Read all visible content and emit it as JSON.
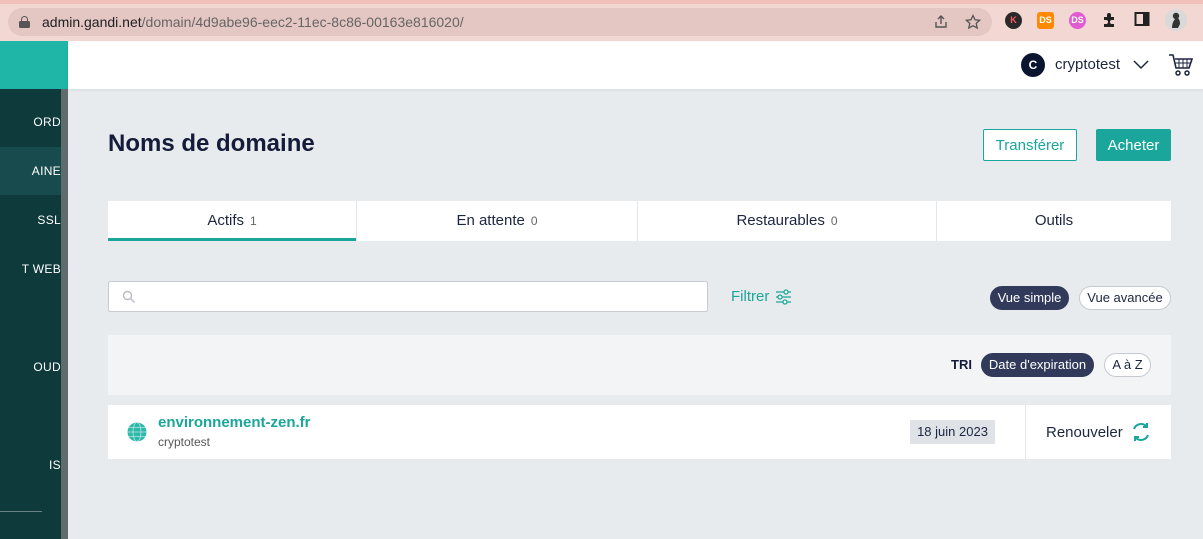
{
  "browser": {
    "url_host": "admin.gandi.net",
    "url_path": "/domain/4d9abe96-eec2-11ec-8c86-00163e816020/",
    "extensions": [
      {
        "name": "k-extension-icon",
        "label": "K"
      },
      {
        "name": "ds-extension-icon",
        "label": "DS"
      },
      {
        "name": "ds-pink-extension-icon",
        "label": "DS"
      }
    ]
  },
  "sidebar": {
    "items": [
      {
        "label": "ORD"
      },
      {
        "label": "AINE"
      },
      {
        "label": "SSL"
      },
      {
        "label": "T WEB"
      },
      {
        "label": "OUD"
      },
      {
        "label": "IS"
      }
    ],
    "active_index": 1
  },
  "header": {
    "avatar_letter": "C",
    "username": "cryptotest"
  },
  "page": {
    "title": "Noms de domaine",
    "transfer_label": "Transférer",
    "buy_label": "Acheter"
  },
  "tabs": [
    {
      "label": "Actifs",
      "count": "1",
      "active": true
    },
    {
      "label": "En attente",
      "count": "0",
      "active": false
    },
    {
      "label": "Restaurables",
      "count": "0",
      "active": false
    },
    {
      "label": "Outils",
      "count": "",
      "active": false
    }
  ],
  "search": {
    "value": "",
    "filter_label": "Filtrer"
  },
  "view": {
    "simple_label": "Vue simple",
    "advanced_label": "Vue avancée",
    "selected": "simple"
  },
  "sort": {
    "label": "TRI",
    "expiration_label": "Date d'expiration",
    "alpha_label": "A à Z",
    "selected": "expiration"
  },
  "domains": [
    {
      "name": "environnement-zen.fr",
      "owner": "cryptotest",
      "expiration": "18 juin 2023",
      "renew_label": "Renouveler"
    }
  ],
  "colors": {
    "accent": "#1aa69a",
    "sidebar_bg": "#0e3a3c",
    "dark_pill": "#313a5a"
  }
}
